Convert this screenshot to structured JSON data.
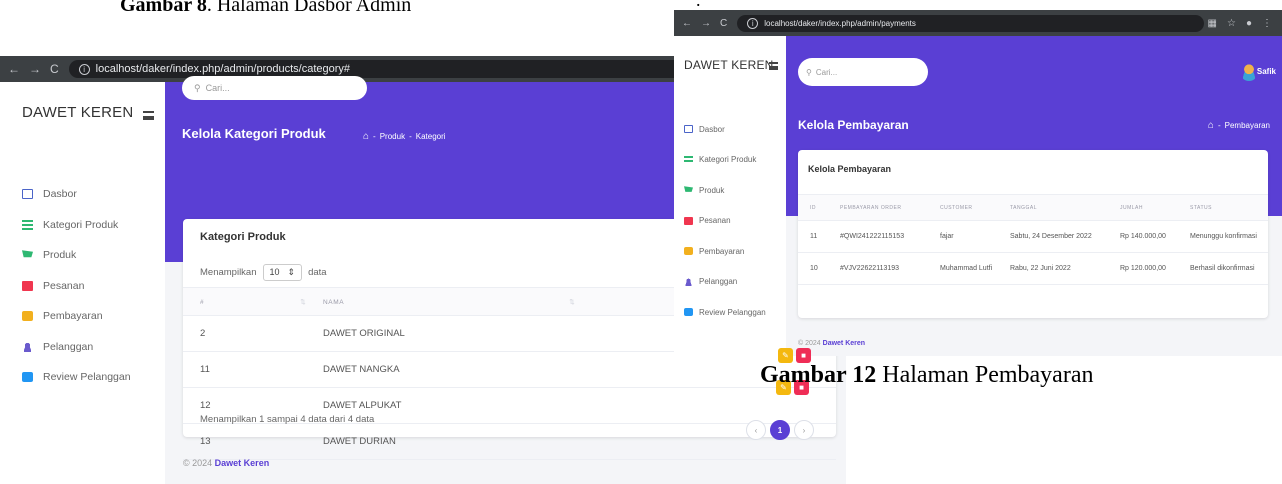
{
  "captions": {
    "top_bold": "Gambar 8",
    "top_rest": ". Halaman Dasbor Admin",
    "bottom_bold": "Gambar 12",
    "bottom_rest": " Halaman Pembayaran",
    "stray_mark": "."
  },
  "left": {
    "url": "localhost/daker/index.php/admin/products/category#",
    "brand": "DAWET KEREN",
    "menu": [
      "Dasbor",
      "Kategori Produk",
      "Produk",
      "Pesanan",
      "Pembayaran",
      "Pelanggan",
      "Review Pelanggan"
    ],
    "search_placeholder": "Cari...",
    "page_title": "Kelola Kategori Produk",
    "breadcrumb": [
      "Produk",
      "Kategori"
    ],
    "card_title": "Kategori Produk",
    "length_prefix": "Menampilkan",
    "length_value": "10",
    "length_suffix": "data",
    "table_headers": [
      "#",
      "NAMA"
    ],
    "rows": [
      {
        "id": "2",
        "name": "DAWET ORIGINAL"
      },
      {
        "id": "11",
        "name": "DAWET NANGKA"
      },
      {
        "id": "12",
        "name": "DAWET ALPUKAT"
      },
      {
        "id": "13",
        "name": "DAWET DURIAN"
      }
    ],
    "info": "Menampilkan 1 sampai 4 data dari 4 data",
    "pager": [
      "‹",
      "1",
      "›"
    ],
    "footer_prefix": "© 2024",
    "footer_brand": "Dawet Keren"
  },
  "right": {
    "url": "localhost/daker/index.php/admin/payments",
    "brand": "DAWET KEREN",
    "menu": [
      "Dasbor",
      "Kategori Produk",
      "Produk",
      "Pesanan",
      "Pembayaran",
      "Pelanggan",
      "Review Pelanggan"
    ],
    "search_placeholder": "Cari...",
    "user_name": "Safik",
    "page_title": "Kelola Pembayaran",
    "breadcrumb": [
      "Pembayaran"
    ],
    "card_title": "Kelola Pembayaran",
    "table_headers": [
      "ID",
      "PEMBAYARAN ORDER",
      "CUSTOMER",
      "TANGGAL",
      "JUMLAH",
      "STATUS"
    ],
    "rows": [
      {
        "id": "11",
        "order": "#QWI241222115153",
        "customer": "fajar",
        "date": "Sabtu, 24 Desember 2022",
        "amount": "Rp 140.000,00",
        "status": "Menunggu konfirmasi"
      },
      {
        "id": "10",
        "order": "#VJV22622113193",
        "customer": "Muhammad Lutfi",
        "date": "Rabu, 22 Juni 2022",
        "amount": "Rp 120.000,00",
        "status": "Berhasil dikonfirmasi"
      }
    ],
    "footer_prefix": "© 2024",
    "footer_brand": "Dawet Keren"
  },
  "colors": {
    "accent": "#5a3fd4",
    "edit": "#f4b80f",
    "delete": "#ef2d56"
  }
}
